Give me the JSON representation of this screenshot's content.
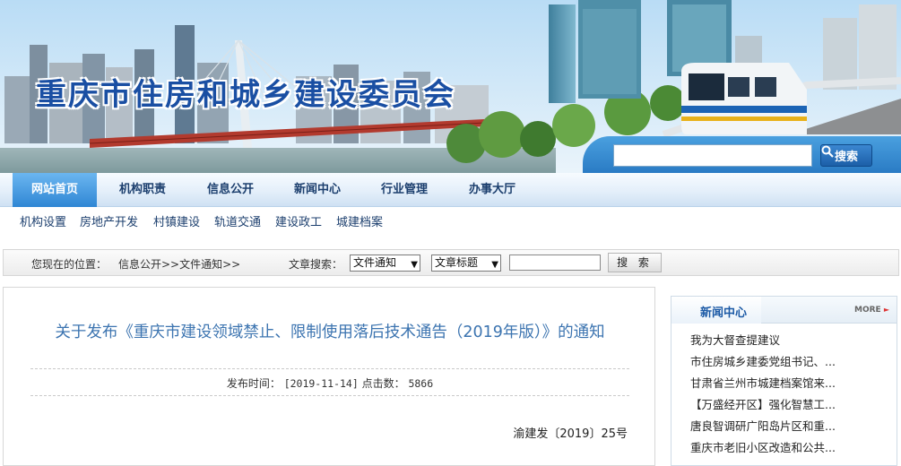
{
  "header": {
    "site_title": "重庆市住房和城乡建设委员会",
    "search_button_label": "搜索",
    "search_input_value": ""
  },
  "nav": {
    "items": [
      "网站首页",
      "机构职责",
      "信息公开",
      "新闻中心",
      "行业管理",
      "办事大厅"
    ],
    "active_index": 0
  },
  "subnav": {
    "items": [
      "机构设置",
      "房地产开发",
      "村镇建设",
      "轨道交通",
      "建设政工",
      "城建档案"
    ]
  },
  "breadcrumb": {
    "prefix": "您现在的位置：",
    "path": "信息公开>>文件通知>>",
    "article_search_label": "文章搜索：",
    "category_select": "文件通知",
    "field_select": "文章标题",
    "keyword_value": "",
    "search_button_label": "搜 索"
  },
  "article": {
    "title": "关于发布《重庆市建设领域禁止、限制使用落后技术通告（2019年版）》的通知",
    "publish_label": "发布时间：",
    "publish_date": "[2019-11-14]",
    "clicks_label": "点击数：",
    "clicks": "5866",
    "doc_number": "渝建发〔2019〕25号"
  },
  "sidebar": {
    "title": "新闻中心",
    "more_label": "MORE",
    "items": [
      "我为大督查提建议",
      "市住房城乡建委党组书记、...",
      "甘肃省兰州市城建档案馆来...",
      "【万盛经开区】强化智慧工...",
      "唐良智调研广阳岛片区和重...",
      "重庆市老旧小区改造和公共..."
    ]
  },
  "colors": {
    "brand_blue": "#1a4fa3",
    "nav_active": "#2f86d4",
    "title_blue": "#3c74b0"
  }
}
